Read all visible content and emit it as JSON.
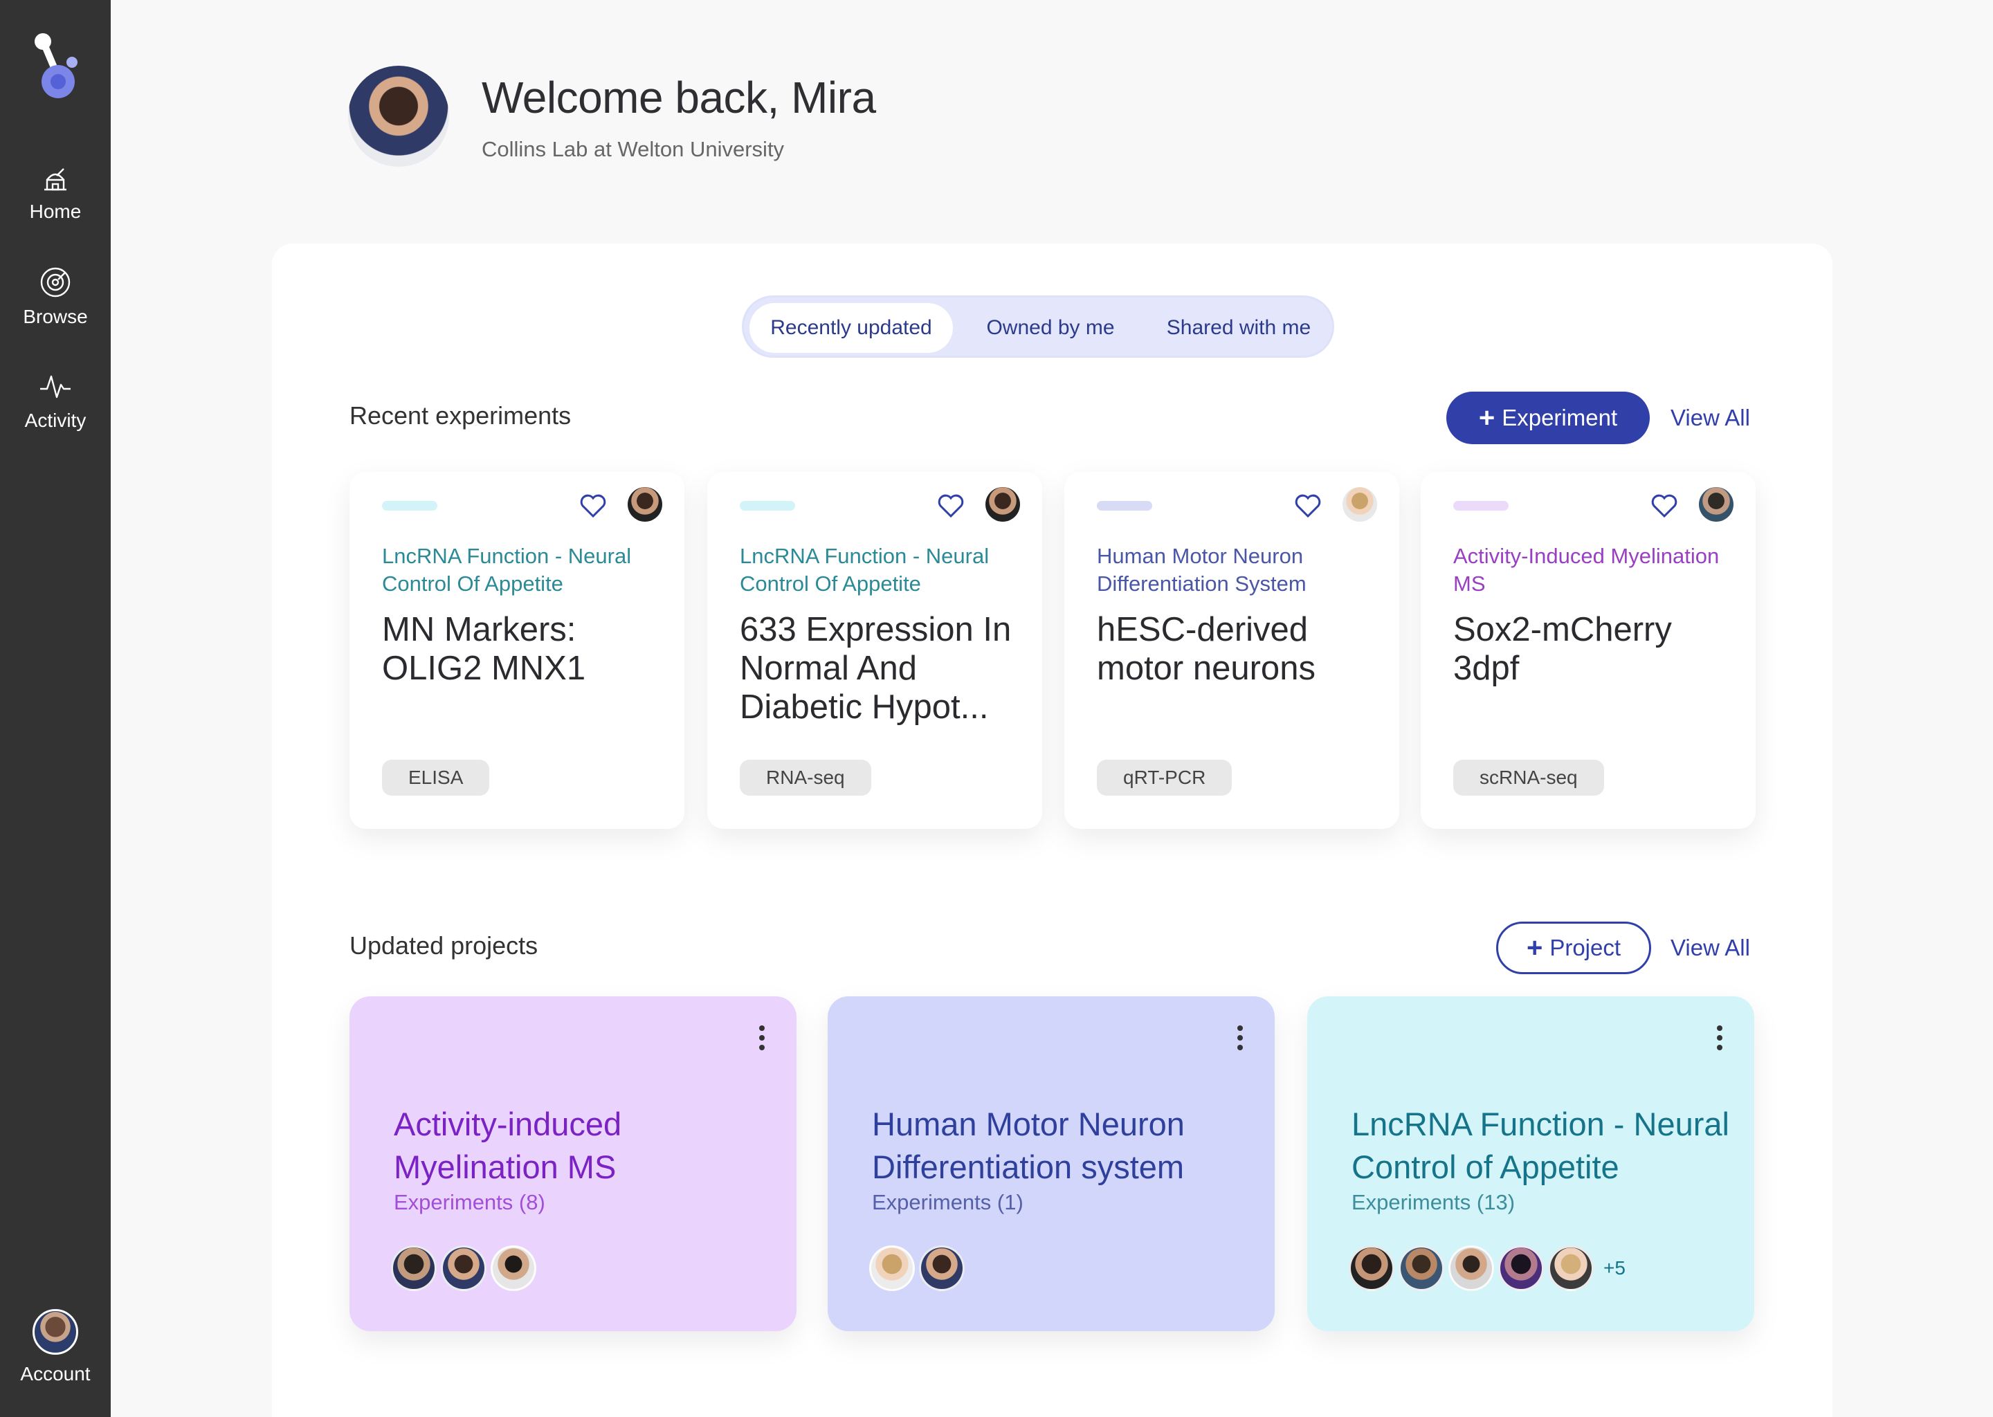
{
  "sidebar": {
    "items": [
      {
        "label": "Home",
        "icon": "observatory-icon"
      },
      {
        "label": "Browse",
        "icon": "target-icon"
      },
      {
        "label": "Activity",
        "icon": "pulse-icon"
      }
    ],
    "account_label": "Account"
  },
  "header": {
    "welcome": "Welcome back, Mira",
    "lab": "Collins Lab at Welton University"
  },
  "tabs": [
    {
      "label": "Recently updated",
      "active": true
    },
    {
      "label": "Owned by me",
      "active": false
    },
    {
      "label": "Shared with me",
      "active": false
    }
  ],
  "experiments_section": {
    "title": "Recent experiments",
    "add_label": "Experiment",
    "view_all": "View All",
    "cards": [
      {
        "project": "LncRNA Function - Neural Control Of Appetite",
        "title": "MN Markers: OLIG2 MNX1",
        "tag": "ELISA",
        "accent": "#d2f3f7",
        "project_color": "#2b8a96"
      },
      {
        "project": "LncRNA Function - Neural Control Of Appetite",
        "title": "633 Expression In Normal And Diabetic Hypot...",
        "tag": "RNA-seq",
        "accent": "#d2f3f7",
        "project_color": "#2b8a96"
      },
      {
        "project": "Human Motor Neuron Differentiation System",
        "title": "hESC-derived motor neurons",
        "tag": "qRT-PCR",
        "accent": "#d7dbf6",
        "project_color": "#4a56a6"
      },
      {
        "project": "Activity-Induced Myelination MS",
        "title": "Sox2-mCherry 3dpf",
        "tag": "scRNA-seq",
        "accent": "#ecdafa",
        "project_color": "#9a3fc2"
      }
    ]
  },
  "projects_section": {
    "title": "Updated projects",
    "add_label": "Project",
    "view_all": "View All",
    "cards": [
      {
        "title": "Activity-induced Myelination MS",
        "count": "Experiments (8)",
        "bg": "#ead3fc",
        "title_color": "#7a22c4",
        "count_color": "#a04fd6",
        "extra": ""
      },
      {
        "title": "Human Motor Neuron Differentiation system",
        "count": "Experiments (1)",
        "bg": "#d2d6fa",
        "title_color": "#2f3f9c",
        "count_color": "#5560a8",
        "extra": ""
      },
      {
        "title": "LncRNA Function - Neural Control of Appetite",
        "count": "Experiments (13)",
        "bg": "#d3f4f8",
        "title_color": "#16748a",
        "count_color": "#3e8d9c",
        "extra": "+5"
      }
    ]
  },
  "colors": {
    "sidebar_bg": "#333333",
    "primary": "#3140a8",
    "background": "#f8f8f9"
  }
}
